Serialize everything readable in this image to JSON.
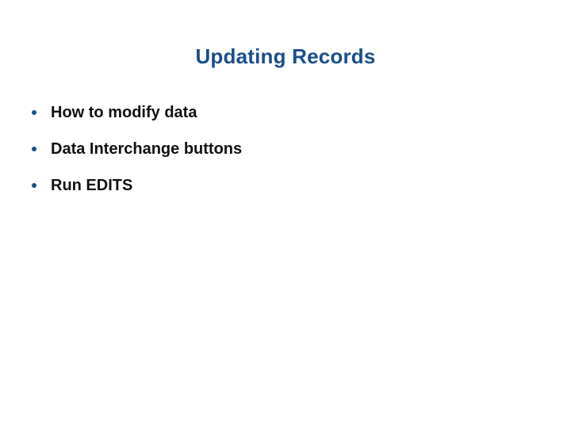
{
  "title": "Updating Records",
  "bullets": [
    {
      "text": "How to modify data"
    },
    {
      "text": "Data Interchange buttons"
    },
    {
      "text": "Run EDITS"
    }
  ]
}
